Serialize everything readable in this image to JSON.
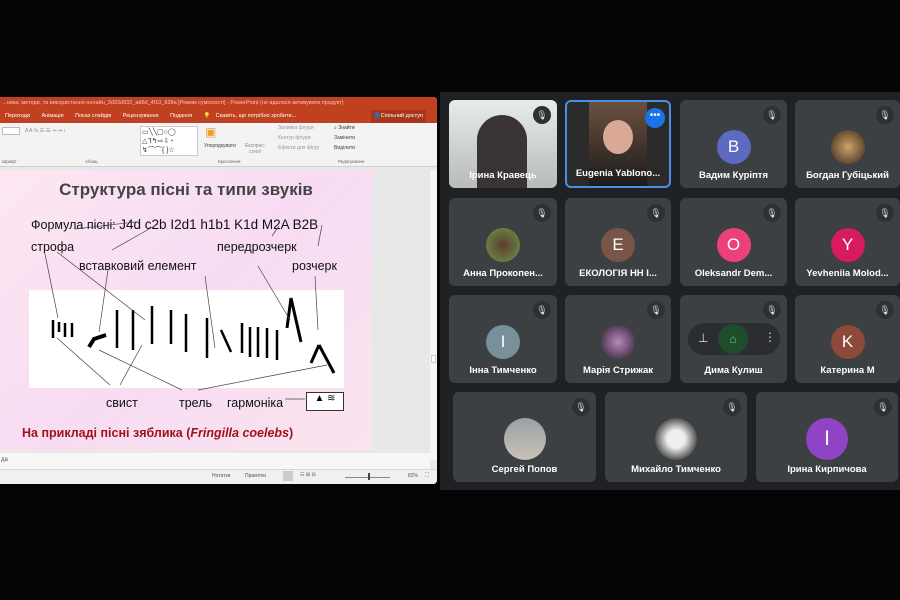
{
  "powerpoint": {
    "title": "...ника, методи, та використання онлайн_3d33d932_ad6d_4f10_828a [Режим сумісності] - PowerPoint (не вдалося активувати продукт)",
    "tabs": [
      "Переходи",
      "Анімація",
      "Показ слайдів",
      "Рецензування",
      "Подання"
    ],
    "tell_me": "Скажіть, що потрібно зробити...",
    "share": "Спільний доступ",
    "ribbon": {
      "arrange": "Упорядкувати",
      "quick_styles": "Експрес-стилі",
      "shape_fill": "Заливка фігури",
      "shape_outline": "Контур фігури",
      "shape_effects": "Ефекти для фігур",
      "find": "Знайти",
      "replace": "Замінити",
      "select": "Виділити",
      "group_font": "Шрифт",
      "group_paragraph": "Абзац",
      "group_drawing": "Креслення",
      "group_editing": "Редагування"
    },
    "slide": {
      "title": "Структура пісні та типи звуків",
      "formula_label": "Формула пісні:",
      "formula": "J4d c2b I2d1 h1b1 K1d M2A B2B",
      "labels": {
        "strofa": "строфа",
        "insert": "вставковий елемент",
        "pre": "передрозчерк",
        "flourish": "розчерк",
        "whistle": "свист",
        "trill": "трель",
        "harmonic": "гармоніка"
      },
      "caption_prefix": "На прикладі пісні зяблика (",
      "caption_latin": "Fringilla coelebs",
      "caption_suffix": ")"
    },
    "notes_stub": "да",
    "status": {
      "notes": "Нотатки",
      "comments": "Примітки",
      "zoom": "82%"
    }
  },
  "meet": {
    "participants": [
      {
        "name": "Ірина Кравець",
        "type": "video"
      },
      {
        "name": "Eugenia Yablono...",
        "type": "video",
        "active": true
      },
      {
        "name": "Вадим Куріптя",
        "initial": "B",
        "color": "#5c6bc0"
      },
      {
        "name": "Богдан Губіцький",
        "type": "photo"
      },
      {
        "name": "Анна Прокопен...",
        "type": "photo"
      },
      {
        "name": "ЕКОЛОГІЯ НН І...",
        "initial": "E",
        "color": "#795548"
      },
      {
        "name": "Oleksandr Dem...",
        "initial": "O",
        "color": "#ec407a"
      },
      {
        "name": "Yevheniia Molod...",
        "initial": "Y",
        "color": "#d81b60"
      },
      {
        "name": "Інна Тимченко",
        "initial": "I",
        "color": "#78909c"
      },
      {
        "name": "Марія Стрижак",
        "type": "photo"
      },
      {
        "name": "Дима Кулиш",
        "type": "hover"
      },
      {
        "name": "Катерина М",
        "initial": "K",
        "color": "#8d4a3a"
      },
      {
        "name": "Сергей Попов",
        "type": "photo"
      },
      {
        "name": "Михайло Тимченко",
        "type": "photo"
      },
      {
        "name": "Ірина Кирпичова",
        "initial": "I",
        "color": "#8e44c4"
      }
    ]
  }
}
